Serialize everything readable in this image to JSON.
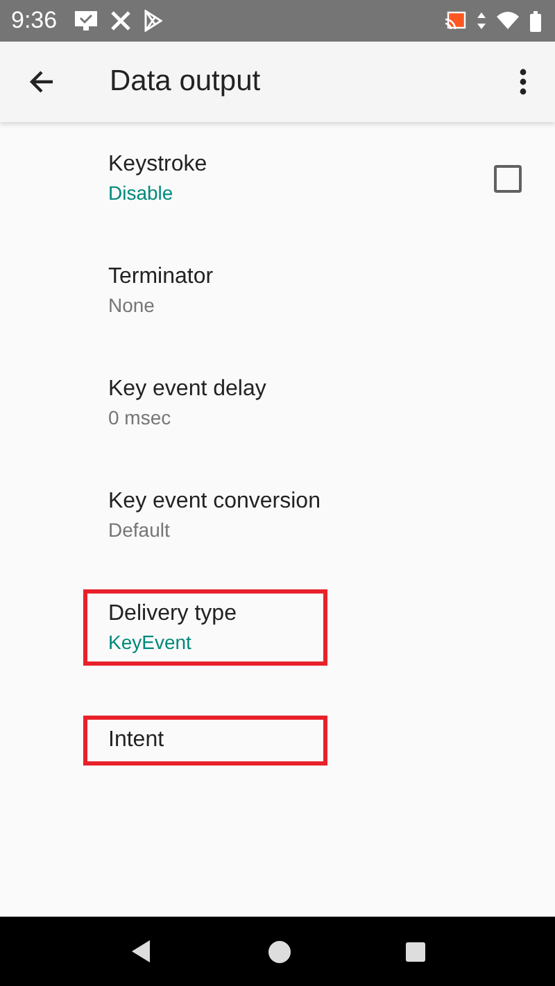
{
  "status_bar": {
    "time": "9:36"
  },
  "app_bar": {
    "title": "Data output"
  },
  "preferences": [
    {
      "kind": "checkbox",
      "title": "Keystroke",
      "summary": "Disable",
      "accent": true,
      "checked": false,
      "highlighted": false
    },
    {
      "kind": "text",
      "title": "Terminator",
      "summary": "None",
      "accent": false,
      "highlighted": false
    },
    {
      "kind": "text",
      "title": "Key event delay",
      "summary": "0 msec",
      "accent": false,
      "highlighted": false
    },
    {
      "kind": "text",
      "title": "Key event conversion",
      "summary": "Default",
      "accent": false,
      "highlighted": false
    },
    {
      "kind": "text",
      "title": "Delivery type",
      "summary": "KeyEvent",
      "accent": true,
      "highlighted": true
    },
    {
      "kind": "text",
      "title": "Intent",
      "highlighted": true
    }
  ]
}
